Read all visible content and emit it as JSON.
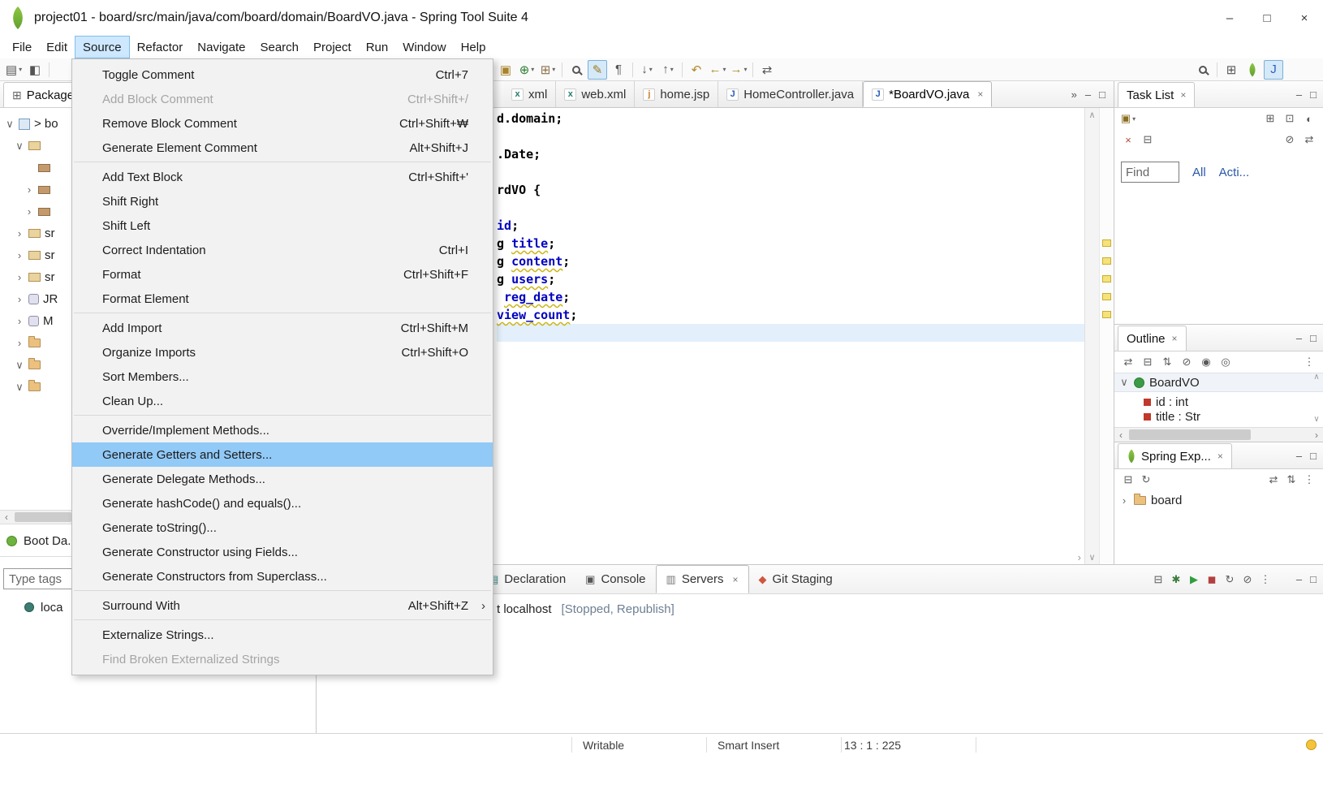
{
  "window": {
    "title": "project01 - board/src/main/java/com/board/domain/BoardVO.java - Spring Tool Suite 4",
    "minimize": "–",
    "maximize": "□",
    "close": "×"
  },
  "menubar": {
    "items": [
      {
        "label": "File"
      },
      {
        "label": "Edit"
      },
      {
        "label": "Source",
        "active": true
      },
      {
        "label": "Refactor"
      },
      {
        "label": "Navigate"
      },
      {
        "label": "Search"
      },
      {
        "label": "Project"
      },
      {
        "label": "Run"
      },
      {
        "label": "Window"
      },
      {
        "label": "Help"
      }
    ]
  },
  "source_menu": {
    "groups": [
      {
        "items": [
          {
            "label": "Toggle Comment",
            "shortcut": "Ctrl+7"
          },
          {
            "label": "Add Block Comment",
            "shortcut": "Ctrl+Shift+/",
            "disabled": true
          },
          {
            "label": "Remove Block Comment",
            "shortcut": "Ctrl+Shift+₩"
          },
          {
            "label": "Generate Element Comment",
            "shortcut": "Alt+Shift+J"
          }
        ]
      },
      {
        "items": [
          {
            "label": "Add Text Block",
            "shortcut": "Ctrl+Shift+'"
          },
          {
            "label": "Shift Right"
          },
          {
            "label": "Shift Left"
          },
          {
            "label": "Correct Indentation",
            "shortcut": "Ctrl+I"
          },
          {
            "label": "Format",
            "shortcut": "Ctrl+Shift+F"
          },
          {
            "label": "Format Element"
          }
        ]
      },
      {
        "items": [
          {
            "label": "Add Import",
            "shortcut": "Ctrl+Shift+M"
          },
          {
            "label": "Organize Imports",
            "shortcut": "Ctrl+Shift+O"
          },
          {
            "label": "Sort Members..."
          },
          {
            "label": "Clean Up..."
          }
        ]
      },
      {
        "items": [
          {
            "label": "Override/Implement Methods..."
          },
          {
            "label": "Generate Getters and Setters...",
            "highlighted": true
          },
          {
            "label": "Generate Delegate Methods..."
          },
          {
            "label": "Generate hashCode() and equals()..."
          },
          {
            "label": "Generate toString()..."
          },
          {
            "label": "Generate Constructor using Fields..."
          },
          {
            "label": "Generate Constructors from Superclass..."
          }
        ]
      },
      {
        "items": [
          {
            "label": "Surround With",
            "shortcut": "Alt+Shift+Z",
            "submenu": true
          }
        ]
      },
      {
        "items": [
          {
            "label": "Externalize Strings..."
          },
          {
            "label": "Find Broken Externalized Strings",
            "disabled": true
          }
        ]
      }
    ]
  },
  "toolbar": {
    "left_icons": [
      {
        "n": "new-wizard",
        "g": "▤",
        "dd": 1
      },
      {
        "n": "save",
        "g": "◧"
      },
      {
        "sep": 1
      }
    ],
    "mid_icons": [
      {
        "n": "open-task",
        "g": "▣",
        "c": "#a8832a"
      },
      {
        "n": "new-java-class",
        "g": "⊕",
        "c": "#2e7d32",
        "dd": 1
      },
      {
        "n": "new-java-package",
        "g": "⊞",
        "c": "#8d6e4a",
        "dd": 1
      },
      {
        "sep": 1
      },
      {
        "n": "search",
        "css": "mag"
      },
      {
        "n": "mark-occurrences",
        "g": "✎",
        "c": "#9a7d1e",
        "on": 1
      },
      {
        "n": "show-whitespace",
        "g": "¶"
      },
      {
        "sep": 1
      },
      {
        "n": "next-annotation",
        "g": "↓",
        "dd": 1
      },
      {
        "n": "prev-annotation",
        "g": "↑",
        "dd": 1
      },
      {
        "sep": 1
      },
      {
        "n": "last-edit-location",
        "g": "↶",
        "c": "#b08a28"
      },
      {
        "n": "back",
        "g": "←",
        "c": "#b08a28",
        "dd": 1
      },
      {
        "n": "forward",
        "g": "→",
        "c": "#b08a28",
        "dd": 1
      },
      {
        "sep": 1
      },
      {
        "n": "link-with-editor",
        "g": "⇄"
      }
    ],
    "right_icons": [
      {
        "n": "search-toolbar",
        "css": "mag"
      },
      {
        "sep": 1
      },
      {
        "n": "open-perspective",
        "g": "⊞"
      },
      {
        "n": "spring-perspective",
        "css": "leaf"
      },
      {
        "n": "java-perspective",
        "g": "J",
        "c": "#2b5fbf",
        "on": 1
      }
    ]
  },
  "editor": {
    "tabs": [
      {
        "label": "xml",
        "icon": "xml"
      },
      {
        "label": "web.xml",
        "icon": "xml"
      },
      {
        "label": "home.jsp",
        "icon": "jsp"
      },
      {
        "label": "HomeController.java",
        "icon": "java"
      },
      {
        "label": "*BoardVO.java",
        "icon": "java",
        "active": true
      }
    ],
    "code_lines": [
      {
        "s": [
          [
            "d.domain;",
            "plain"
          ]
        ]
      },
      {
        "s": []
      },
      {
        "s": [
          [
            ".Date;",
            "plain"
          ]
        ]
      },
      {
        "s": []
      },
      {
        "s": [
          [
            "rdVO {",
            "plain"
          ]
        ]
      },
      {
        "s": []
      },
      {
        "s": [
          [
            "id",
            "field"
          ],
          [
            ";",
            "plain"
          ]
        ]
      },
      {
        "s": [
          [
            "g ",
            "plain"
          ],
          [
            "title",
            "field warn"
          ],
          [
            ";",
            "plain"
          ]
        ]
      },
      {
        "s": [
          [
            "g ",
            "plain"
          ],
          [
            "content",
            "field warn"
          ],
          [
            ";",
            "plain"
          ]
        ]
      },
      {
        "s": [
          [
            "g ",
            "plain"
          ],
          [
            "users",
            "field warn"
          ],
          [
            ";",
            "plain"
          ]
        ]
      },
      {
        "s": [
          [
            " ",
            "plain"
          ],
          [
            "reg_date",
            "field warn"
          ],
          [
            ";",
            "plain"
          ]
        ]
      },
      {
        "s": [
          [
            "view_count",
            "field warn"
          ],
          [
            ";",
            "plain"
          ]
        ]
      },
      {
        "s": [],
        "hl": true
      }
    ]
  },
  "package_explorer": {
    "title": "Package",
    "rows": [
      {
        "chev": "v",
        "icon": "project",
        "label": "> bo",
        "indent": 0
      },
      {
        "chev": "v",
        "icon": "src",
        "label": "",
        "indent": 1
      },
      {
        "chev": "",
        "icon": "pkg",
        "label": "",
        "indent": 2
      },
      {
        "chev": ">",
        "icon": "pkg",
        "label": "",
        "indent": 2
      },
      {
        "chev": ">",
        "icon": "pkg",
        "label": "",
        "indent": 2
      },
      {
        "chev": ">",
        "icon": "src",
        "label": "sr",
        "indent": 1
      },
      {
        "chev": ">",
        "icon": "src",
        "label": "sr",
        "indent": 1
      },
      {
        "chev": ">",
        "icon": "src",
        "label": "sr",
        "indent": 1
      },
      {
        "chev": ">",
        "icon": "lib",
        "label": "JR",
        "indent": 1
      },
      {
        "chev": ">",
        "icon": "lib",
        "label": "M",
        "indent": 1
      },
      {
        "chev": ">",
        "icon": "folder",
        "label": "",
        "indent": 1
      },
      {
        "chev": "v",
        "icon": "folder",
        "label": "",
        "indent": 1
      },
      {
        "chev": "v",
        "icon": "folder",
        "label": "",
        "indent": 1
      }
    ]
  },
  "boot_dashboard": {
    "title": "Boot Da...",
    "filter_placeholder": "Type tags",
    "items": [
      {
        "label": "loca"
      }
    ]
  },
  "task_list": {
    "title": "Task List",
    "find_value": "Find",
    "links": [
      {
        "label": "All"
      },
      {
        "label": "Acti..."
      }
    ],
    "toolbar1": [
      {
        "n": "new-task",
        "g": "▣",
        "c": "#8a6d1f",
        "dd": 1
      },
      {
        "sp": 1
      },
      {
        "n": "categorized",
        "g": "⊞"
      },
      {
        "n": "scheduled",
        "g": "⊡"
      },
      {
        "n": "focus-workweek",
        "g": "◐"
      }
    ],
    "toolbar2": [
      {
        "n": "delete-task",
        "g": "×",
        "c": "#b04a3a"
      },
      {
        "n": "collapse-all",
        "g": "⊟"
      },
      {
        "sp": 1
      },
      {
        "n": "filter",
        "g": "⊘"
      },
      {
        "n": "link-with-editor",
        "g": "⇄"
      }
    ]
  },
  "outline": {
    "title": "Outline",
    "icons": [
      {
        "n": "link-with-editor",
        "g": "⇄"
      },
      {
        "n": "collapse-all",
        "g": "⊟"
      },
      {
        "n": "sort",
        "g": "⇅"
      },
      {
        "n": "hide-fields",
        "g": "⊘"
      },
      {
        "n": "hide-static",
        "g": "◉"
      },
      {
        "n": "hide-non-public",
        "g": "◎"
      },
      {
        "sp": 1
      },
      {
        "n": "view-menu",
        "g": "⋮"
      }
    ],
    "rows": [
      {
        "chev": "v",
        "icon": "class",
        "label": "BoardVO",
        "sel": true
      },
      {
        "icon": "field",
        "label": "id : int",
        "indent": 1
      },
      {
        "icon": "field",
        "label": "title : Str",
        "indent": 1,
        "clipped": true
      }
    ]
  },
  "spring_explorer": {
    "title": "Spring Exp...",
    "icons_left": [
      {
        "n": "collapse-all",
        "g": "⊟"
      },
      {
        "n": "refresh",
        "g": "↻"
      }
    ],
    "icons_right": [
      {
        "n": "link-with-editor",
        "g": "⇄"
      },
      {
        "n": "sort",
        "g": "⇅"
      },
      {
        "n": "view-menu",
        "g": "⋮"
      }
    ],
    "rows": [
      {
        "label": "board"
      }
    ]
  },
  "bottom_panel": {
    "tabs": [
      {
        "label": "Declaration",
        "icon": "decl"
      },
      {
        "label": "Console",
        "icon": "console"
      },
      {
        "label": "Servers",
        "icon": "server",
        "active": true
      },
      {
        "label": "Git Staging",
        "icon": "git"
      }
    ],
    "icons": [
      {
        "n": "collapse-all",
        "g": "⊟"
      },
      {
        "n": "debug-server",
        "g": "✱",
        "c": "#3c7d3c"
      },
      {
        "n": "start-server",
        "g": "▶",
        "c": "#2f9e3e"
      },
      {
        "n": "stop-server",
        "g": "◼",
        "c": "#b34040"
      },
      {
        "n": "publish",
        "g": "↻"
      },
      {
        "n": "clean",
        "g": "⊘"
      },
      {
        "n": "view-menu",
        "g": "⋮"
      }
    ],
    "server_prefix": "t localhost",
    "server_status": "[Stopped, Republish]"
  },
  "status_bar": {
    "writable": "Writable",
    "insert_mode": "Smart Insert",
    "position": "13 : 1 : 225"
  },
  "colors": {
    "menu_selection": "#91c9f7",
    "menubar_highlight": "#cde8ff",
    "field_blue": "#0000c0",
    "warning_yellow": "#cdb616",
    "link_blue": "#2b57a8",
    "current_line": "#e3f0fb",
    "spring_green": "#6db33f"
  }
}
